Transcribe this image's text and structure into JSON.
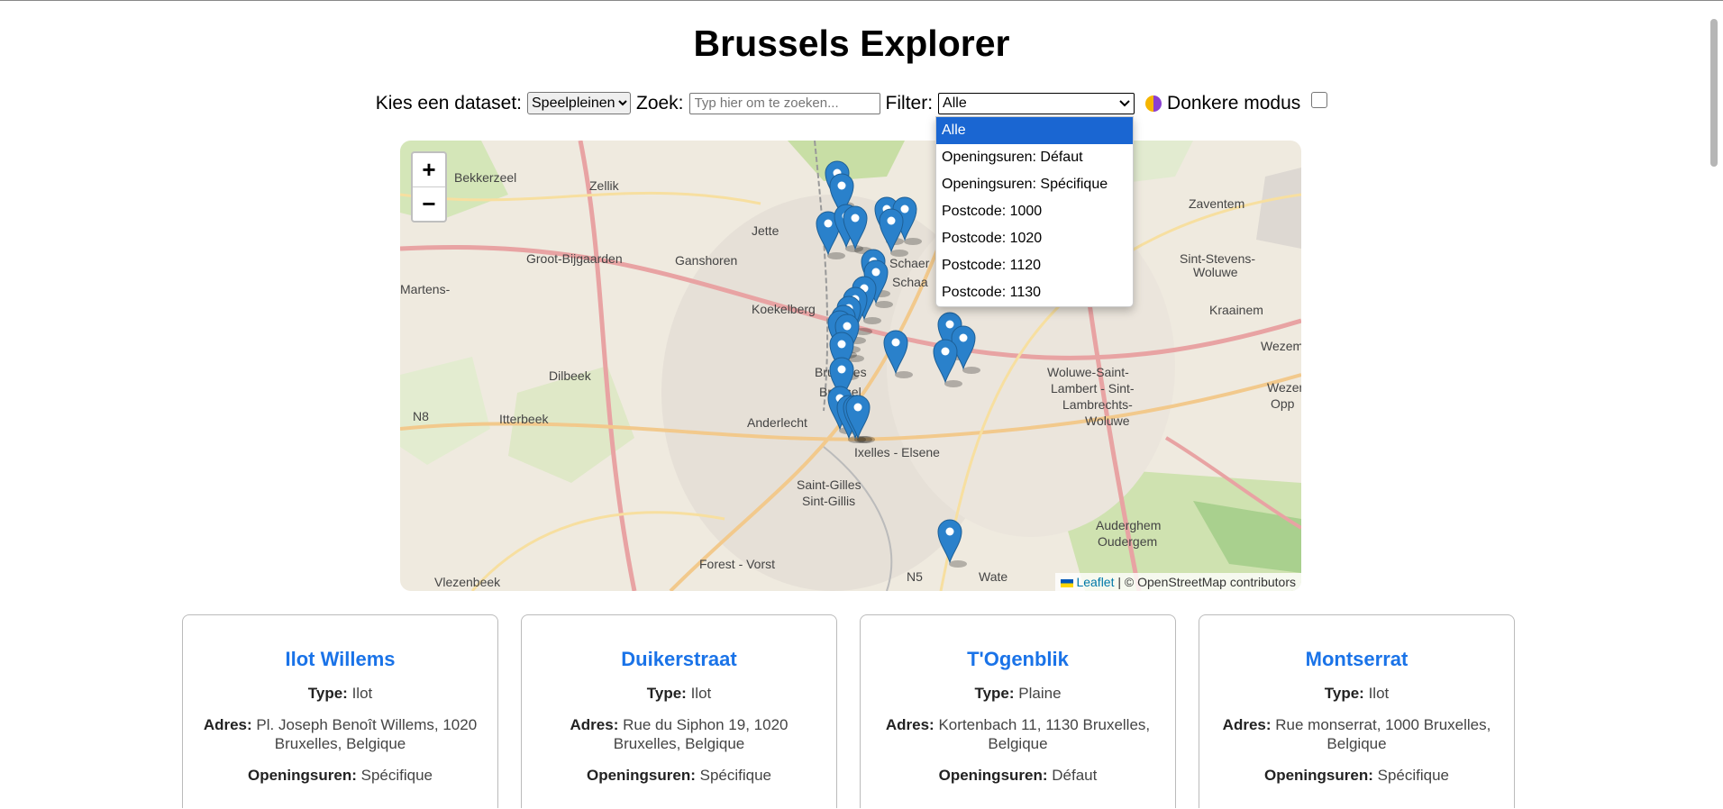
{
  "page": {
    "title": "Brussels Explorer"
  },
  "controls": {
    "dataset_label": "Kies een dataset:",
    "dataset_value": "Speelpleinen",
    "search_label": "Zoek:",
    "search_placeholder": "Typ hier om te zoeken...",
    "filter_label": "Filter:",
    "filter_value": "Alle",
    "darkmode_label": "Donkere modus"
  },
  "filter_options": [
    "Alle",
    "Openingsuren: Défaut",
    "Openingsuren: Spécifique",
    "Postcode: 1000",
    "Postcode: 1020",
    "Postcode: 1120",
    "Postcode: 1130"
  ],
  "map": {
    "zoom_in": "+",
    "zoom_out": "−",
    "attribution_leaflet": "Leaflet",
    "attribution_osm": "| © OpenStreetMap contributors",
    "place_labels": [
      "Bekkerzeel",
      "Zellik",
      "Jette",
      "Ganshoren",
      "Groot-Bijgaarden",
      "Koekelberg",
      "Martens-",
      "Dilbeek",
      "Itterbeek",
      "Anderlecht",
      "Bruxelles",
      "Brussel",
      "Ixelles - Elsene",
      "Saint-Gilles",
      "Sint-Gillis",
      "Forest - Vorst",
      "Vlezenbeek",
      "Zaventem",
      "Sint-Stevens-",
      "Woluwe",
      "Kraainem",
      "Woluwe-Saint-",
      "Lambert - Sint-",
      "Lambrechts-",
      "Woluwe",
      "Auderghem",
      "Oudergem",
      "Wezembe",
      "Wezen",
      "Opp",
      "N8",
      "N5",
      "Schaer",
      "Schaa",
      "Wate"
    ]
  },
  "cards": [
    {
      "title": "Ilot Willems",
      "type_label": "Type:",
      "type": "Ilot",
      "address_label": "Adres:",
      "address": "Pl. Joseph Benoît Willems, 1020 Bruxelles, Belgique",
      "hours_label": "Openingsuren:",
      "hours": "Spécifique"
    },
    {
      "title": "Duikerstraat",
      "type_label": "Type:",
      "type": "Ilot",
      "address_label": "Adres:",
      "address": "Rue du Siphon 19, 1020 Bruxelles, Belgique",
      "hours_label": "Openingsuren:",
      "hours": "Spécifique"
    },
    {
      "title": "T'Ogenblik",
      "type_label": "Type:",
      "type": "Plaine",
      "address_label": "Adres:",
      "address": "Kortenbach 11, 1130 Bruxelles, Belgique",
      "hours_label": "Openingsuren:",
      "hours": "Défaut"
    },
    {
      "title": "Montserrat",
      "type_label": "Type:",
      "type": "Ilot",
      "address_label": "Adres:",
      "address": "Rue monserrat, 1000 Bruxelles, Belgique",
      "hours_label": "Openingsuren:",
      "hours": "Spécifique"
    }
  ],
  "colors": {
    "accent": "#1a73e8",
    "marker": "#2a81cb",
    "dropdown_selected": "#1a66d2"
  },
  "icons": {
    "theme": "theme-toggle-icon",
    "marker": "map-marker-icon"
  }
}
